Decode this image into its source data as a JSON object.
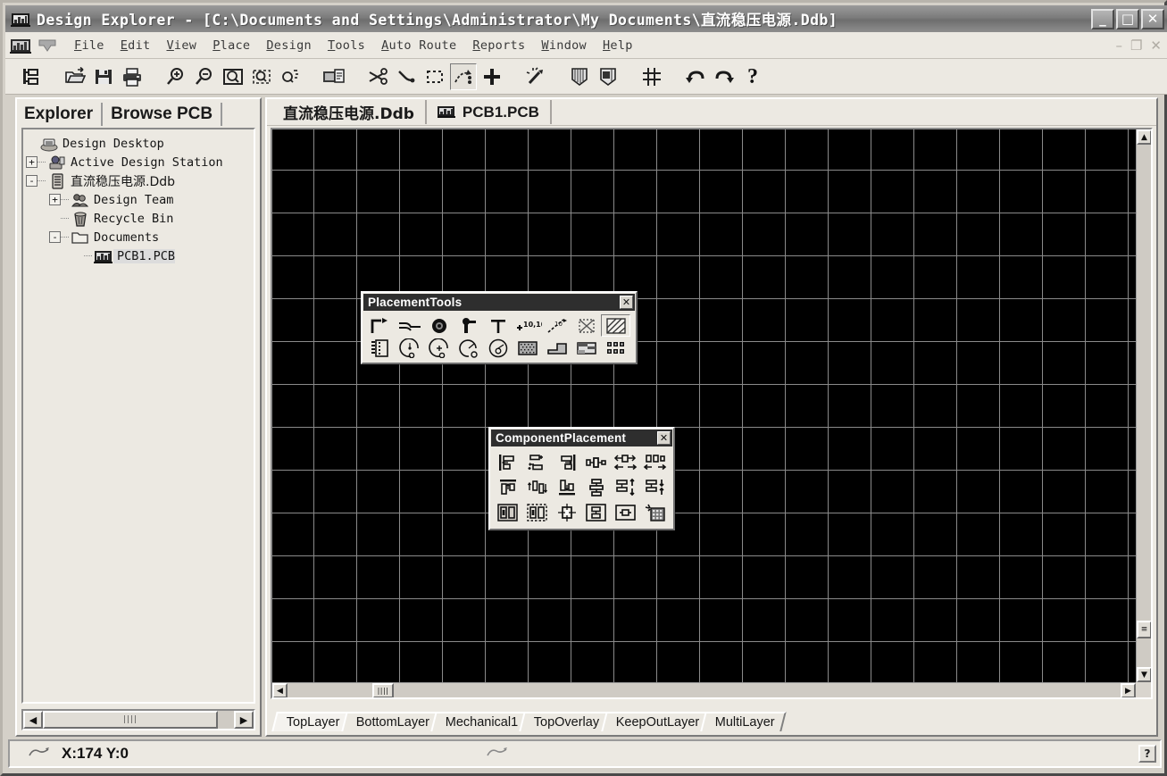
{
  "window": {
    "title": "Design Explorer - [C:\\Documents and Settings\\Administrator\\My Documents\\直流稳压电源.Ddb]",
    "app_icon": "design-explorer-icon",
    "buttons": {
      "minimize": "_",
      "maximize": "□",
      "close": "✕"
    },
    "mdi_buttons": {
      "minimize": "–",
      "restore": "❐",
      "close": "✕"
    }
  },
  "menubar": {
    "items": [
      {
        "label": "File",
        "accel": "F"
      },
      {
        "label": "Edit",
        "accel": "E"
      },
      {
        "label": "View",
        "accel": "V"
      },
      {
        "label": "Place",
        "accel": "P"
      },
      {
        "label": "Design",
        "accel": "D"
      },
      {
        "label": "Tools",
        "accel": "T"
      },
      {
        "label": "Auto Route",
        "accel": "A"
      },
      {
        "label": "Reports",
        "accel": "R"
      },
      {
        "label": "Window",
        "accel": "W"
      },
      {
        "label": "Help",
        "accel": "H"
      }
    ]
  },
  "toolbar": {
    "items": [
      {
        "name": "design-hierarchy-icon",
        "tooltip": "Design Hierarchy"
      },
      {
        "sep": true
      },
      {
        "name": "open-folder-icon",
        "tooltip": "Open"
      },
      {
        "name": "save-icon",
        "tooltip": "Save"
      },
      {
        "name": "print-icon",
        "tooltip": "Print"
      },
      {
        "sep": true
      },
      {
        "name": "zoom-in-icon",
        "tooltip": "Zoom In"
      },
      {
        "name": "zoom-out-icon",
        "tooltip": "Zoom Out"
      },
      {
        "name": "zoom-document-icon",
        "tooltip": "Fit Document"
      },
      {
        "name": "zoom-area-icon",
        "tooltip": "Zoom Area"
      },
      {
        "name": "zoom-selection-icon",
        "tooltip": "Zoom Selection"
      },
      {
        "sep": true
      },
      {
        "name": "paste-icon",
        "tooltip": "Paste"
      },
      {
        "sep": true
      },
      {
        "name": "cut-traces-icon",
        "tooltip": "Cut Traces"
      },
      {
        "name": "route-icon",
        "tooltip": "Interactive Route"
      },
      {
        "name": "select-area-icon",
        "tooltip": "Select Inside Area"
      },
      {
        "name": "move-selection-icon",
        "tooltip": "Move Selection",
        "pressed": true
      },
      {
        "name": "move-icon",
        "tooltip": "Move"
      },
      {
        "sep": true
      },
      {
        "name": "highlight-net-icon",
        "tooltip": "Highlight Net"
      },
      {
        "sep": true
      },
      {
        "name": "browse-component-icon",
        "tooltip": "Browse Component"
      },
      {
        "name": "browse-library-icon",
        "tooltip": "Browse Library"
      },
      {
        "sep": true
      },
      {
        "name": "grid-toggle-icon",
        "tooltip": "Toggle Grid"
      },
      {
        "sep": true
      },
      {
        "name": "undo-icon",
        "tooltip": "Undo"
      },
      {
        "name": "redo-icon",
        "tooltip": "Redo"
      },
      {
        "name": "help-icon",
        "tooltip": "Help"
      }
    ]
  },
  "sidebar": {
    "tabs": [
      {
        "label": "Explorer",
        "active": true
      },
      {
        "label": "Browse PCB",
        "active": false
      }
    ],
    "tree": [
      {
        "label": "Design Desktop",
        "indent": 0,
        "expander": "",
        "icon": "desktop-icon",
        "selected": false,
        "cjk": false
      },
      {
        "label": "Active Design Station",
        "indent": 0,
        "expander": "+",
        "icon": "station-icon",
        "selected": false,
        "cjk": false
      },
      {
        "label": "直流稳压电源.Ddb",
        "indent": 0,
        "expander": "-",
        "icon": "database-icon",
        "selected": false,
        "cjk": true
      },
      {
        "label": "Design Team",
        "indent": 1,
        "expander": "+",
        "icon": "team-icon",
        "selected": false,
        "cjk": false
      },
      {
        "label": "Recycle Bin",
        "indent": 1,
        "expander": "",
        "icon": "recycle-bin-icon",
        "selected": false,
        "cjk": false
      },
      {
        "label": "Documents",
        "indent": 1,
        "expander": "-",
        "icon": "folder-icon",
        "selected": false,
        "cjk": false
      },
      {
        "label": "PCB1.PCB",
        "indent": 2,
        "expander": "",
        "icon": "pcb-document-icon",
        "selected": true,
        "cjk": false
      }
    ],
    "hscroll": {
      "left_arrow": "◀",
      "right_arrow": "▶",
      "thumb": "||||"
    }
  },
  "document_tabs": [
    {
      "label": "直流稳压电源.Ddb",
      "icon": "",
      "active": false,
      "cjk": true
    },
    {
      "label": "PCB1.PCB",
      "icon": "pcb-document-icon",
      "active": true,
      "cjk": false
    }
  ],
  "canvas": {
    "background_color": "#000000",
    "grid_color": "#8a8a8a",
    "grid_spacing_px": 48,
    "vscroll": {
      "up_arrow": "▲",
      "down_arrow": "▼",
      "thumb": "≡"
    },
    "hscroll": {
      "left_arrow": "◀",
      "right_arrow": "▶",
      "thumb": "||||"
    }
  },
  "layer_tabs": [
    {
      "label": "TopLayer",
      "active": true
    },
    {
      "label": "BottomLayer",
      "active": false
    },
    {
      "label": "Mechanical1",
      "active": false
    },
    {
      "label": "TopOverlay",
      "active": false
    },
    {
      "label": "KeepOutLayer",
      "active": false
    },
    {
      "label": "MultiLayer",
      "active": false
    }
  ],
  "palettes": [
    {
      "id": "placement-tools",
      "title": "PlacementTools",
      "close_label": "✕",
      "rows": [
        [
          {
            "name": "place-interactive-routing-icon",
            "selected": false
          },
          {
            "name": "place-line-icon",
            "selected": false
          },
          {
            "name": "place-pad-icon",
            "selected": false
          },
          {
            "name": "place-via-icon",
            "selected": false
          },
          {
            "name": "place-string-icon",
            "selected": false
          },
          {
            "name": "place-coordinate-icon",
            "selected": false
          },
          {
            "name": "place-dimension-icon",
            "selected": false
          },
          {
            "name": "place-room-icon",
            "selected": false
          },
          {
            "name": "place-polygon-plane-icon",
            "selected": true
          }
        ],
        [
          {
            "name": "place-component-icon",
            "selected": false
          },
          {
            "name": "place-arc-center-icon",
            "selected": false
          },
          {
            "name": "place-arc-edge-icon",
            "selected": false
          },
          {
            "name": "place-arc-any-angle-icon",
            "selected": false
          },
          {
            "name": "place-full-circle-icon",
            "selected": false
          },
          {
            "name": "place-fill-icon",
            "selected": false
          },
          {
            "name": "place-split-plane-icon",
            "selected": false
          },
          {
            "name": "place-plane-cutout-icon",
            "selected": false
          },
          {
            "name": "place-array-icon",
            "selected": false
          }
        ]
      ]
    },
    {
      "id": "component-placement",
      "title": "ComponentPlacement",
      "close_label": "✕",
      "rows": [
        [
          {
            "name": "align-left-icon"
          },
          {
            "name": "align-horizontal-center-icon"
          },
          {
            "name": "align-right-icon"
          },
          {
            "name": "space-equally-horizontal-icon"
          },
          {
            "name": "increase-horizontal-spacing-icon"
          },
          {
            "name": "decrease-horizontal-spacing-icon"
          }
        ],
        [
          {
            "name": "align-top-icon"
          },
          {
            "name": "align-vertical-center-icon"
          },
          {
            "name": "align-bottom-icon"
          },
          {
            "name": "space-equally-vertical-icon"
          },
          {
            "name": "increase-vertical-spacing-icon"
          },
          {
            "name": "decrease-vertical-spacing-icon"
          }
        ],
        [
          {
            "name": "arrange-components-in-room-icon"
          },
          {
            "name": "arrange-components-in-rectangle-icon"
          },
          {
            "name": "move-to-grid-icon"
          },
          {
            "name": "position-component-text-icon"
          },
          {
            "name": "place-component-in-box-icon"
          },
          {
            "name": "interactive-placement-icon"
          }
        ]
      ]
    }
  ],
  "statusbar": {
    "coordinate": "X:174 Y:0",
    "left_glyph": "pen-glyph",
    "mid_glyph": "pen-glyph",
    "help_button": "?"
  }
}
